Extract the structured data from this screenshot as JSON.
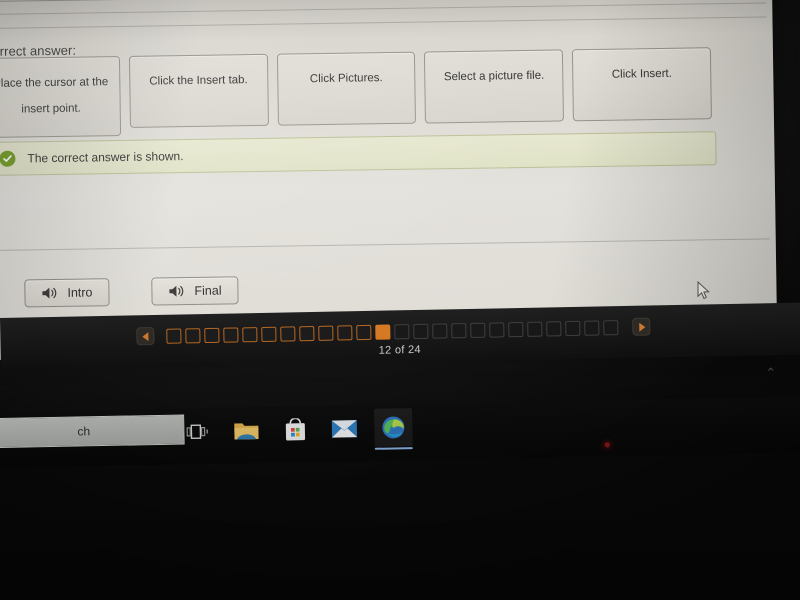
{
  "quiz": {
    "correct_answer_label": "Correct answer:",
    "top_row_tiles": [
      "",
      "",
      "",
      "",
      ""
    ],
    "answer_steps": [
      "Place the cursor at the insert point.",
      "Click the Insert tab.",
      "Click Pictures.",
      "Select a picture file.",
      "Click Insert."
    ],
    "feedback": {
      "icon": "check-circle-icon",
      "text": "The correct answer is shown.",
      "accent_color": "#6f9a1e",
      "background_color": "#e3e4ca"
    },
    "audio_buttons": [
      {
        "icon": "speaker-icon",
        "label": "Intro"
      },
      {
        "icon": "speaker-icon",
        "label": "Final"
      }
    ]
  },
  "pagination": {
    "prev_icon": "triangle-left-icon",
    "next_icon": "triangle-right-icon",
    "current": 12,
    "total": 24,
    "counter_text": "12 of 24",
    "visited_count": 11,
    "remaining_count": 12,
    "current_color": "#d4771f",
    "visited_color": "#b5651f",
    "remaining_color": "#3b3b3b"
  },
  "taskbar": {
    "search_value": "ch",
    "items": [
      {
        "icon": "task-view-icon",
        "label": "Task View",
        "active": false
      },
      {
        "icon": "file-explorer-icon",
        "label": "File Explorer",
        "active": false
      },
      {
        "icon": "microsoft-store-icon",
        "label": "Microsoft Store",
        "active": false
      },
      {
        "icon": "mail-icon",
        "label": "Mail",
        "active": false
      },
      {
        "icon": "microsoft-edge-icon",
        "label": "Microsoft Edge",
        "active": true
      }
    ],
    "tray_chevron": "⌃"
  }
}
